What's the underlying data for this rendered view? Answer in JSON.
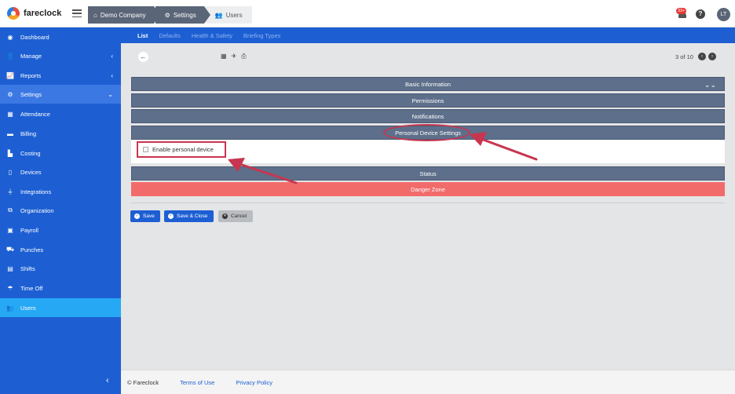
{
  "header": {
    "logo_text": "fareclock",
    "breadcrumbs": [
      {
        "label": "Demo Company",
        "icon": "home-icon"
      },
      {
        "label": "Settings",
        "icon": "gear-icon"
      },
      {
        "label": "Users",
        "icon": "users-icon"
      }
    ],
    "notification_count": "33+",
    "help_label": "?",
    "avatar_initials": "LT"
  },
  "sidebar": {
    "items": [
      {
        "label": "Dashboard",
        "icon": "dashboard-icon"
      },
      {
        "label": "Manage",
        "icon": "user-icon",
        "chevron": "‹"
      },
      {
        "label": "Reports",
        "icon": "chart-icon",
        "chevron": "‹"
      },
      {
        "label": "Settings",
        "icon": "gear-icon",
        "chevron": "⌄"
      },
      {
        "label": "Attendance",
        "icon": "calendar-grid-icon"
      },
      {
        "label": "Billing",
        "icon": "credit-card-icon"
      },
      {
        "label": "Costing",
        "icon": "industry-icon"
      },
      {
        "label": "Devices",
        "icon": "tablet-icon"
      },
      {
        "label": "Integrations",
        "icon": "plug-icon"
      },
      {
        "label": "Organization",
        "icon": "sitemap-icon"
      },
      {
        "label": "Payroll",
        "icon": "money-icon"
      },
      {
        "label": "Punches",
        "icon": "punch-icon"
      },
      {
        "label": "Shifts",
        "icon": "calendar-icon"
      },
      {
        "label": "Time Off",
        "icon": "umbrella-beach-icon"
      },
      {
        "label": "Users",
        "icon": "users-icon"
      }
    ],
    "collapse_label": "‹"
  },
  "subtabs": [
    "List",
    "Defaults",
    "Health & Safety",
    "Briefing Types"
  ],
  "toolbar": {
    "back_label": "←",
    "tools": [
      "▦",
      "✈",
      "⎙"
    ],
    "pager_text": "3 of 10",
    "prev_label": "‹",
    "next_label": "›"
  },
  "sections": [
    {
      "title": "Basic Information"
    },
    {
      "title": "Permissions"
    },
    {
      "title": "Notifications"
    },
    {
      "title": "Personal Device Settings"
    },
    {
      "title": "Status"
    },
    {
      "title": "Danger Zone"
    }
  ],
  "personal_device": {
    "checkbox_label": "Enable personal device",
    "checked": false
  },
  "actions": {
    "save": "Save",
    "save_close": "Save & Close",
    "cancel": "Cancel"
  },
  "footer": {
    "copyright": "© Fareclock",
    "terms": "Terms of Use",
    "privacy": "Privacy Policy"
  },
  "colors": {
    "sidebar": "#1d5fd3",
    "active": "#27a8f4",
    "section": "#5d6f8a",
    "danger": "#f26b6b",
    "annotation": "#c8354f"
  }
}
